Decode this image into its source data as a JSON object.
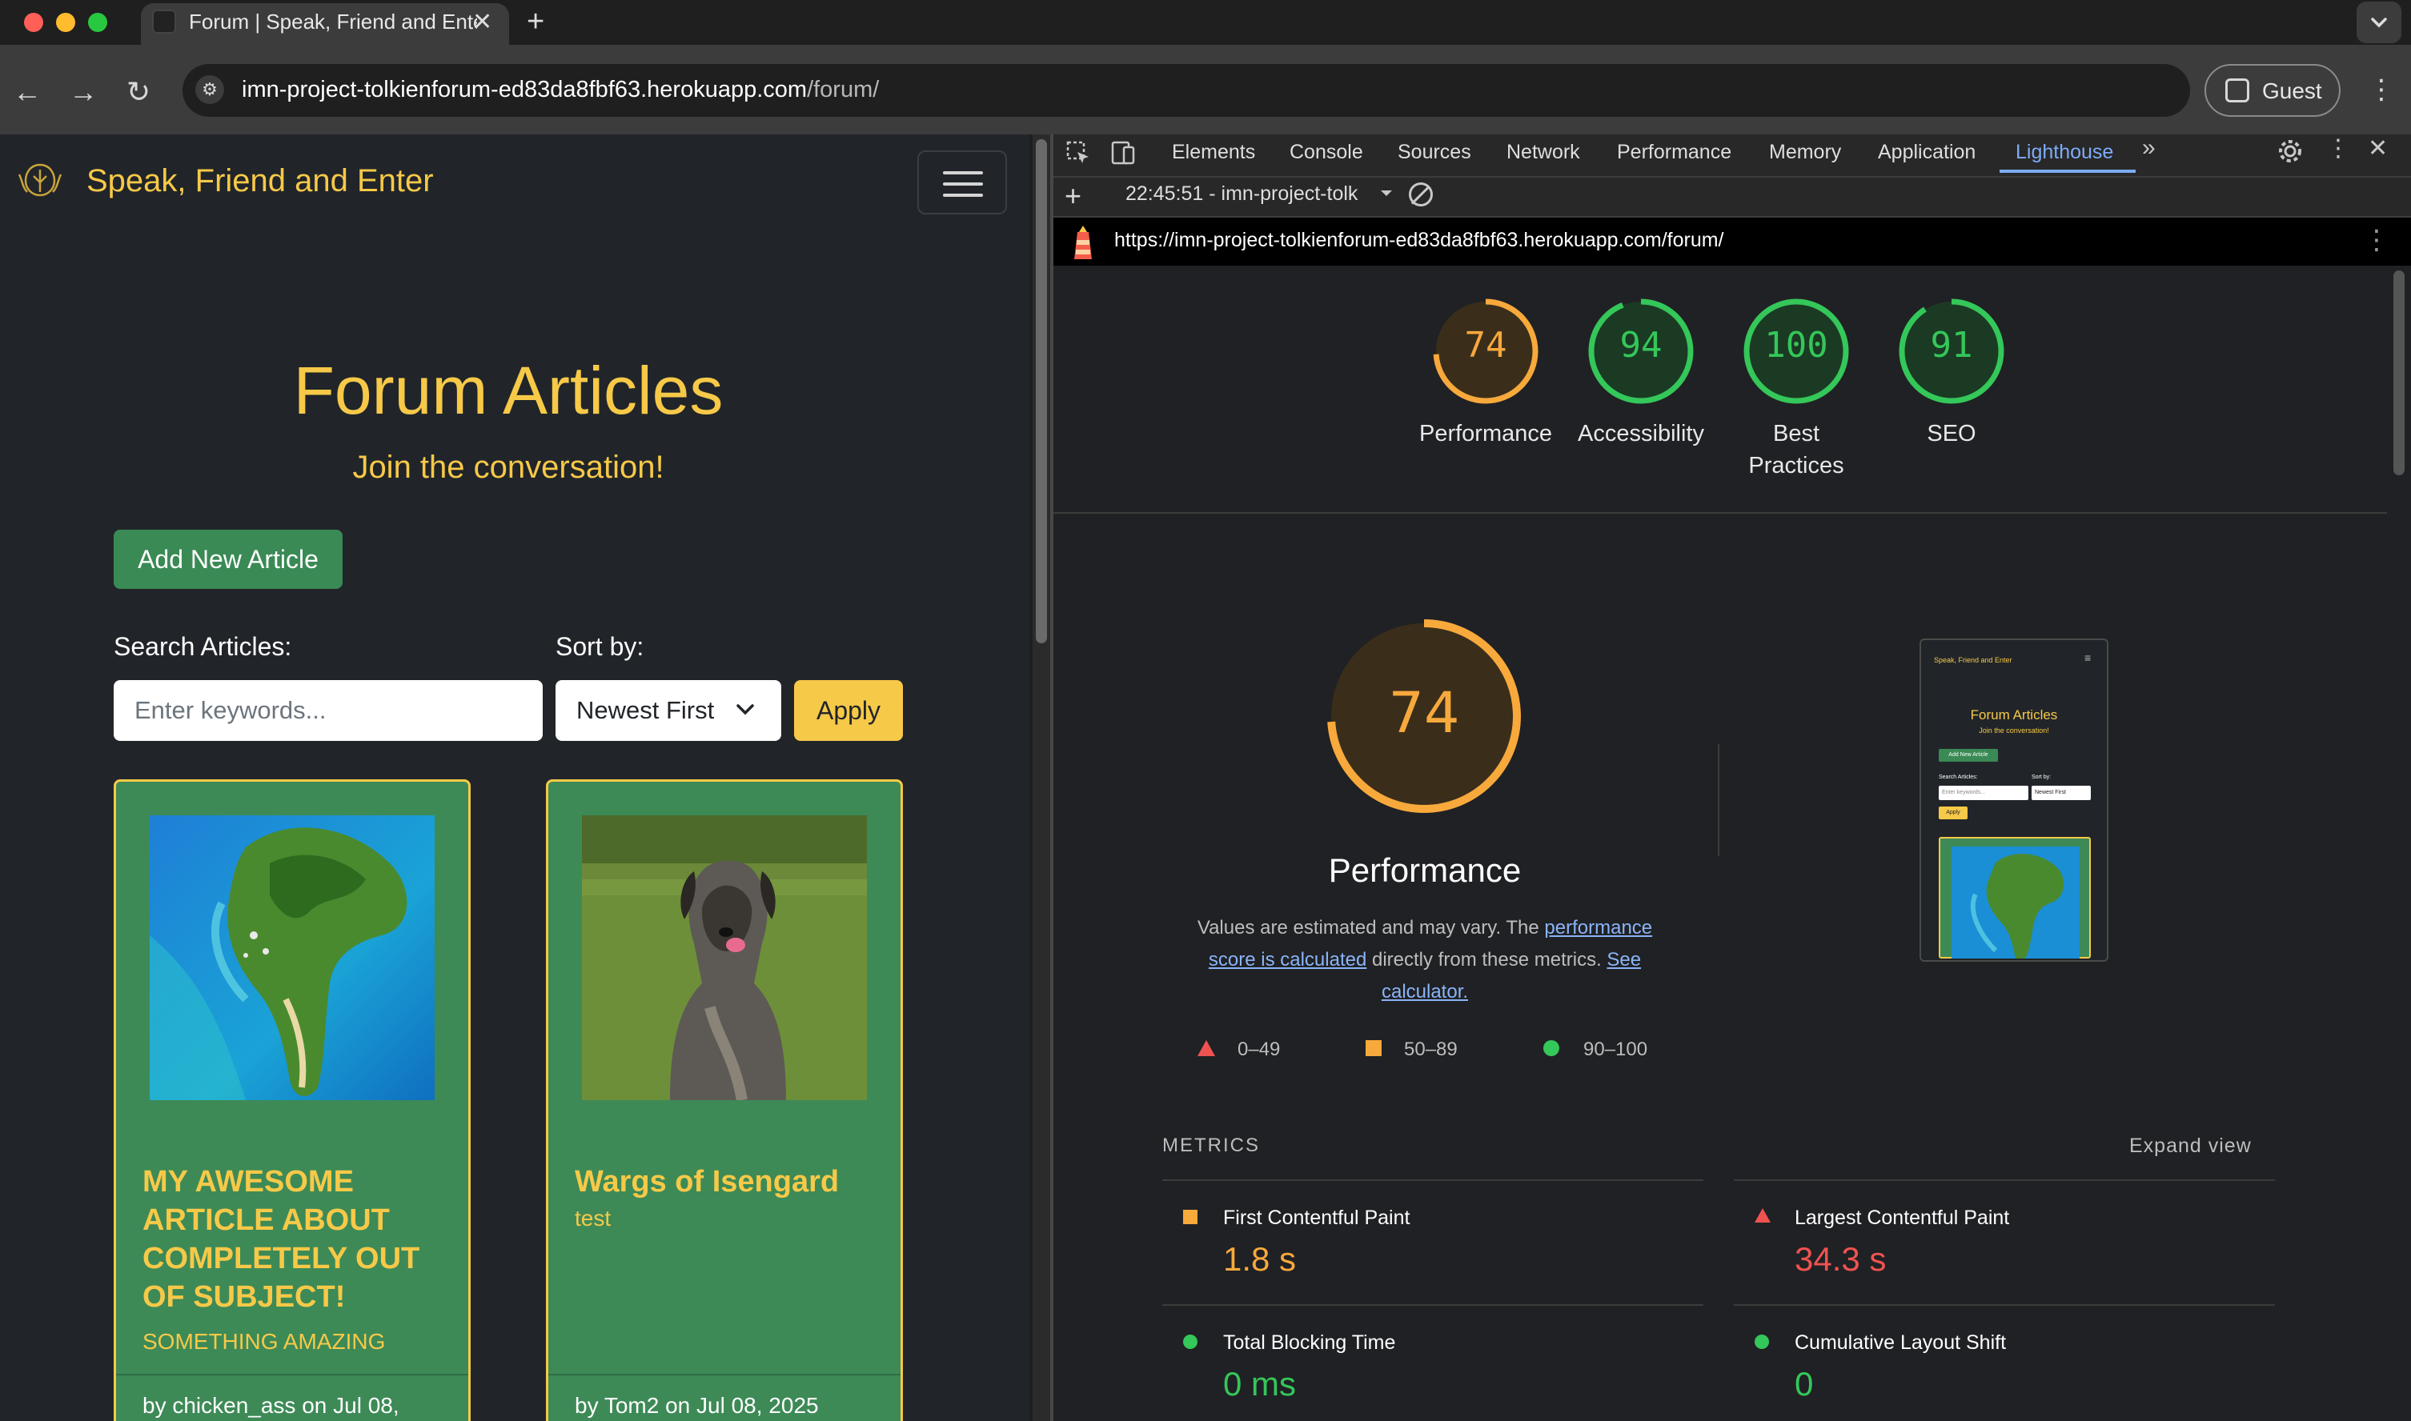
{
  "browser": {
    "tab_title": "Forum | Speak, Friend and Enter",
    "url_host": "imn-project-tolkienforum-ed83da8fbf63.herokuapp.com",
    "url_path": "/forum/",
    "profile_label": "Guest",
    "icons": [
      "back-icon",
      "forward-icon",
      "reload-icon",
      "site-info-icon",
      "new-tab-icon",
      "close-tab-icon",
      "menu-icon"
    ]
  },
  "site": {
    "brand": "Speak, Friend and Enter",
    "title": "Forum Articles",
    "subtitle": "Join the conversation!",
    "add_button": "Add New Article",
    "search_label": "Search Articles:",
    "search_placeholder": "Enter keywords...",
    "sort_label": "Sort by:",
    "sort_value": "Newest First",
    "apply_button": "Apply",
    "colors": {
      "accent": "#f7c948",
      "card": "#3d8a57",
      "background": "#212529"
    },
    "articles": [
      {
        "title": "MY AWESOME ARTICLE ABOUT COMPLETELY OUT OF SUBJECT!",
        "subtitle": "SOMETHING AMAZING",
        "byline": "by chicken_ass on Jul 08,"
      },
      {
        "title": "Wargs of Isengard",
        "subtitle": "test",
        "byline": "by Tom2 on Jul 08, 2025"
      }
    ]
  },
  "devtools": {
    "tabs": [
      "Elements",
      "Console",
      "Sources",
      "Network",
      "Performance",
      "Memory",
      "Application",
      "Lighthouse"
    ],
    "active_tab": "Lighthouse",
    "report_label": "22:45:51 - imn-project-tolk",
    "lighthouse_url": "https://imn-project-tolkienforum-ed83da8fbf63.herokuapp.com/forum/",
    "scores": [
      {
        "value": 74,
        "label": "Performance",
        "color": "#f7a93c"
      },
      {
        "value": 94,
        "label": "Accessibility",
        "color": "#34c759"
      },
      {
        "value": 100,
        "label": "Best Practices",
        "color": "#34c759"
      },
      {
        "value": 91,
        "label": "SEO",
        "color": "#34c759"
      }
    ],
    "main_score": {
      "value": 74,
      "label": "Performance"
    },
    "desc": {
      "prefix": "Values are estimated and may vary. The ",
      "link1": "performance score is calculated",
      "middle": " directly from these metrics. ",
      "link2": "See calculator."
    },
    "legend": [
      "0–49",
      "50–89",
      "90–100"
    ],
    "metrics_title": "METRICS",
    "expand_label": "Expand view",
    "metrics": [
      {
        "name": "First Contentful Paint",
        "value": "1.8 s",
        "status": "average"
      },
      {
        "name": "Largest Contentful Paint",
        "value": "34.3 s",
        "status": "fail"
      },
      {
        "name": "Total Blocking Time",
        "value": "0 ms",
        "status": "pass"
      },
      {
        "name": "Cumulative Layout Shift",
        "value": "0",
        "status": "pass"
      }
    ],
    "thumbnail": {
      "brand": "Speak, Friend and Enter",
      "title": "Forum Articles",
      "subtitle": "Join the conversation!",
      "add_button": "Add New Article",
      "search_label": "Search Articles:",
      "sort_label": "Sort by:",
      "search_placeholder": "Enter keywords...",
      "sort_value": "Newest First",
      "apply_button": "Apply"
    }
  }
}
